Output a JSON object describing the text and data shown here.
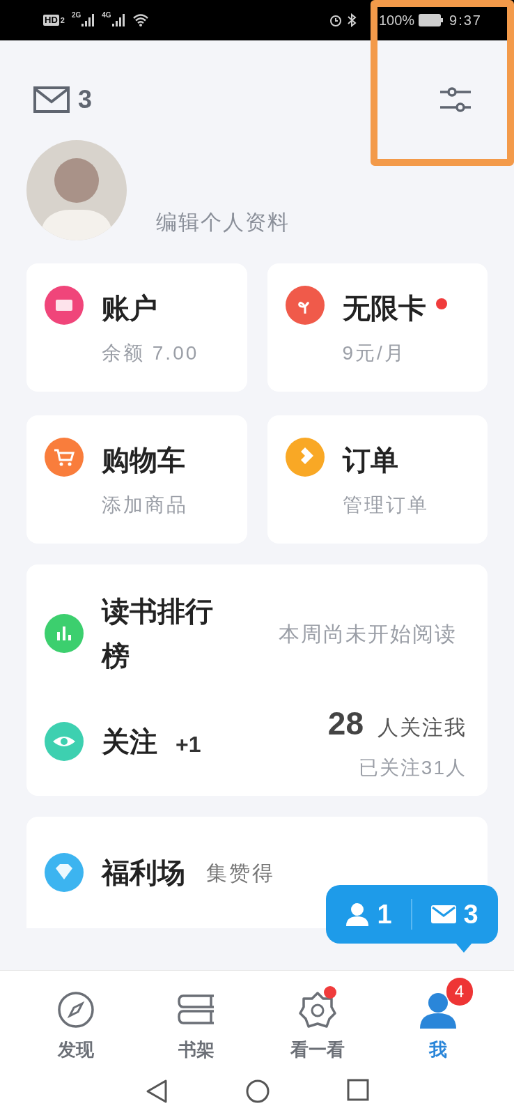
{
  "status_bar": {
    "hd": "HD",
    "sim": "2",
    "net_1": "2G",
    "net_2": "4G",
    "battery": "100%",
    "time": "9:37"
  },
  "header": {
    "mail_count": "3"
  },
  "profile": {
    "edit_link": "编辑个人资料"
  },
  "tiles": [
    {
      "kind": "account",
      "title": "账户",
      "subtitle": "余额 7.00",
      "color": "#f0457a",
      "dot": false
    },
    {
      "kind": "card",
      "title": "无限卡",
      "subtitle": "9元/月",
      "color": "#f05a4a",
      "dot": true
    },
    {
      "kind": "cart",
      "title": "购物车",
      "subtitle": "添加商品",
      "color": "#f97d3c",
      "dot": false
    },
    {
      "kind": "order",
      "title": "订单",
      "subtitle": "管理订单",
      "color": "#f9a825",
      "dot": false
    }
  ],
  "ranking": {
    "title": "读书排行榜",
    "note": "本周尚未开始阅读"
  },
  "follow": {
    "title": "关注",
    "delta": "+1",
    "count": "28",
    "count_label": "人关注我",
    "following": "已关注31人"
  },
  "welfare": {
    "title": "福利场",
    "note": "集赞得"
  },
  "popup": {
    "followers": "1",
    "messages": "3"
  },
  "tabs": [
    {
      "kind": "discover",
      "label": "发现",
      "selected": false,
      "dot": false
    },
    {
      "kind": "shelf",
      "label": "书架",
      "selected": false,
      "dot": false
    },
    {
      "kind": "look",
      "label": "看一看",
      "selected": false,
      "dot": true
    },
    {
      "kind": "me",
      "label": "我",
      "selected": true,
      "dot": false,
      "badge": "4"
    }
  ]
}
